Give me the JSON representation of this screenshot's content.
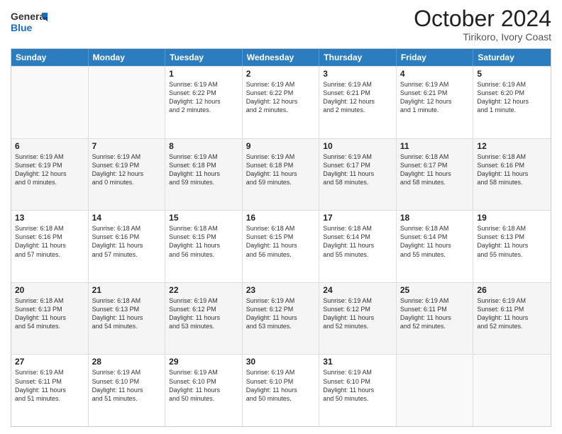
{
  "logo": {
    "general": "General",
    "blue": "Blue"
  },
  "header": {
    "month": "October 2024",
    "location": "Tirikoro, Ivory Coast"
  },
  "weekdays": [
    "Sunday",
    "Monday",
    "Tuesday",
    "Wednesday",
    "Thursday",
    "Friday",
    "Saturday"
  ],
  "weeks": [
    [
      {
        "day": "",
        "info": [],
        "empty": true
      },
      {
        "day": "",
        "info": [],
        "empty": true
      },
      {
        "day": "1",
        "info": [
          "Sunrise: 6:19 AM",
          "Sunset: 6:22 PM",
          "Daylight: 12 hours",
          "and 2 minutes."
        ]
      },
      {
        "day": "2",
        "info": [
          "Sunrise: 6:19 AM",
          "Sunset: 6:22 PM",
          "Daylight: 12 hours",
          "and 2 minutes."
        ]
      },
      {
        "day": "3",
        "info": [
          "Sunrise: 6:19 AM",
          "Sunset: 6:21 PM",
          "Daylight: 12 hours",
          "and 2 minutes."
        ]
      },
      {
        "day": "4",
        "info": [
          "Sunrise: 6:19 AM",
          "Sunset: 6:21 PM",
          "Daylight: 12 hours",
          "and 1 minute."
        ]
      },
      {
        "day": "5",
        "info": [
          "Sunrise: 6:19 AM",
          "Sunset: 6:20 PM",
          "Daylight: 12 hours",
          "and 1 minute."
        ]
      }
    ],
    [
      {
        "day": "6",
        "info": [
          "Sunrise: 6:19 AM",
          "Sunset: 6:19 PM",
          "Daylight: 12 hours",
          "and 0 minutes."
        ]
      },
      {
        "day": "7",
        "info": [
          "Sunrise: 6:19 AM",
          "Sunset: 6:19 PM",
          "Daylight: 12 hours",
          "and 0 minutes."
        ]
      },
      {
        "day": "8",
        "info": [
          "Sunrise: 6:19 AM",
          "Sunset: 6:18 PM",
          "Daylight: 11 hours",
          "and 59 minutes."
        ]
      },
      {
        "day": "9",
        "info": [
          "Sunrise: 6:19 AM",
          "Sunset: 6:18 PM",
          "Daylight: 11 hours",
          "and 59 minutes."
        ]
      },
      {
        "day": "10",
        "info": [
          "Sunrise: 6:19 AM",
          "Sunset: 6:17 PM",
          "Daylight: 11 hours",
          "and 58 minutes."
        ]
      },
      {
        "day": "11",
        "info": [
          "Sunrise: 6:18 AM",
          "Sunset: 6:17 PM",
          "Daylight: 11 hours",
          "and 58 minutes."
        ]
      },
      {
        "day": "12",
        "info": [
          "Sunrise: 6:18 AM",
          "Sunset: 6:16 PM",
          "Daylight: 11 hours",
          "and 58 minutes."
        ]
      }
    ],
    [
      {
        "day": "13",
        "info": [
          "Sunrise: 6:18 AM",
          "Sunset: 6:16 PM",
          "Daylight: 11 hours",
          "and 57 minutes."
        ]
      },
      {
        "day": "14",
        "info": [
          "Sunrise: 6:18 AM",
          "Sunset: 6:16 PM",
          "Daylight: 11 hours",
          "and 57 minutes."
        ]
      },
      {
        "day": "15",
        "info": [
          "Sunrise: 6:18 AM",
          "Sunset: 6:15 PM",
          "Daylight: 11 hours",
          "and 56 minutes."
        ]
      },
      {
        "day": "16",
        "info": [
          "Sunrise: 6:18 AM",
          "Sunset: 6:15 PM",
          "Daylight: 11 hours",
          "and 56 minutes."
        ]
      },
      {
        "day": "17",
        "info": [
          "Sunrise: 6:18 AM",
          "Sunset: 6:14 PM",
          "Daylight: 11 hours",
          "and 55 minutes."
        ]
      },
      {
        "day": "18",
        "info": [
          "Sunrise: 6:18 AM",
          "Sunset: 6:14 PM",
          "Daylight: 11 hours",
          "and 55 minutes."
        ]
      },
      {
        "day": "19",
        "info": [
          "Sunrise: 6:18 AM",
          "Sunset: 6:13 PM",
          "Daylight: 11 hours",
          "and 55 minutes."
        ]
      }
    ],
    [
      {
        "day": "20",
        "info": [
          "Sunrise: 6:18 AM",
          "Sunset: 6:13 PM",
          "Daylight: 11 hours",
          "and 54 minutes."
        ]
      },
      {
        "day": "21",
        "info": [
          "Sunrise: 6:18 AM",
          "Sunset: 6:13 PM",
          "Daylight: 11 hours",
          "and 54 minutes."
        ]
      },
      {
        "day": "22",
        "info": [
          "Sunrise: 6:19 AM",
          "Sunset: 6:12 PM",
          "Daylight: 11 hours",
          "and 53 minutes."
        ]
      },
      {
        "day": "23",
        "info": [
          "Sunrise: 6:19 AM",
          "Sunset: 6:12 PM",
          "Daylight: 11 hours",
          "and 53 minutes."
        ]
      },
      {
        "day": "24",
        "info": [
          "Sunrise: 6:19 AM",
          "Sunset: 6:12 PM",
          "Daylight: 11 hours",
          "and 52 minutes."
        ]
      },
      {
        "day": "25",
        "info": [
          "Sunrise: 6:19 AM",
          "Sunset: 6:11 PM",
          "Daylight: 11 hours",
          "and 52 minutes."
        ]
      },
      {
        "day": "26",
        "info": [
          "Sunrise: 6:19 AM",
          "Sunset: 6:11 PM",
          "Daylight: 11 hours",
          "and 52 minutes."
        ]
      }
    ],
    [
      {
        "day": "27",
        "info": [
          "Sunrise: 6:19 AM",
          "Sunset: 6:11 PM",
          "Daylight: 11 hours",
          "and 51 minutes."
        ]
      },
      {
        "day": "28",
        "info": [
          "Sunrise: 6:19 AM",
          "Sunset: 6:10 PM",
          "Daylight: 11 hours",
          "and 51 minutes."
        ]
      },
      {
        "day": "29",
        "info": [
          "Sunrise: 6:19 AM",
          "Sunset: 6:10 PM",
          "Daylight: 11 hours",
          "and 50 minutes."
        ]
      },
      {
        "day": "30",
        "info": [
          "Sunrise: 6:19 AM",
          "Sunset: 6:10 PM",
          "Daylight: 11 hours",
          "and 50 minutes."
        ]
      },
      {
        "day": "31",
        "info": [
          "Sunrise: 6:19 AM",
          "Sunset: 6:10 PM",
          "Daylight: 11 hours",
          "and 50 minutes."
        ]
      },
      {
        "day": "",
        "info": [],
        "empty": true
      },
      {
        "day": "",
        "info": [],
        "empty": true
      }
    ]
  ]
}
